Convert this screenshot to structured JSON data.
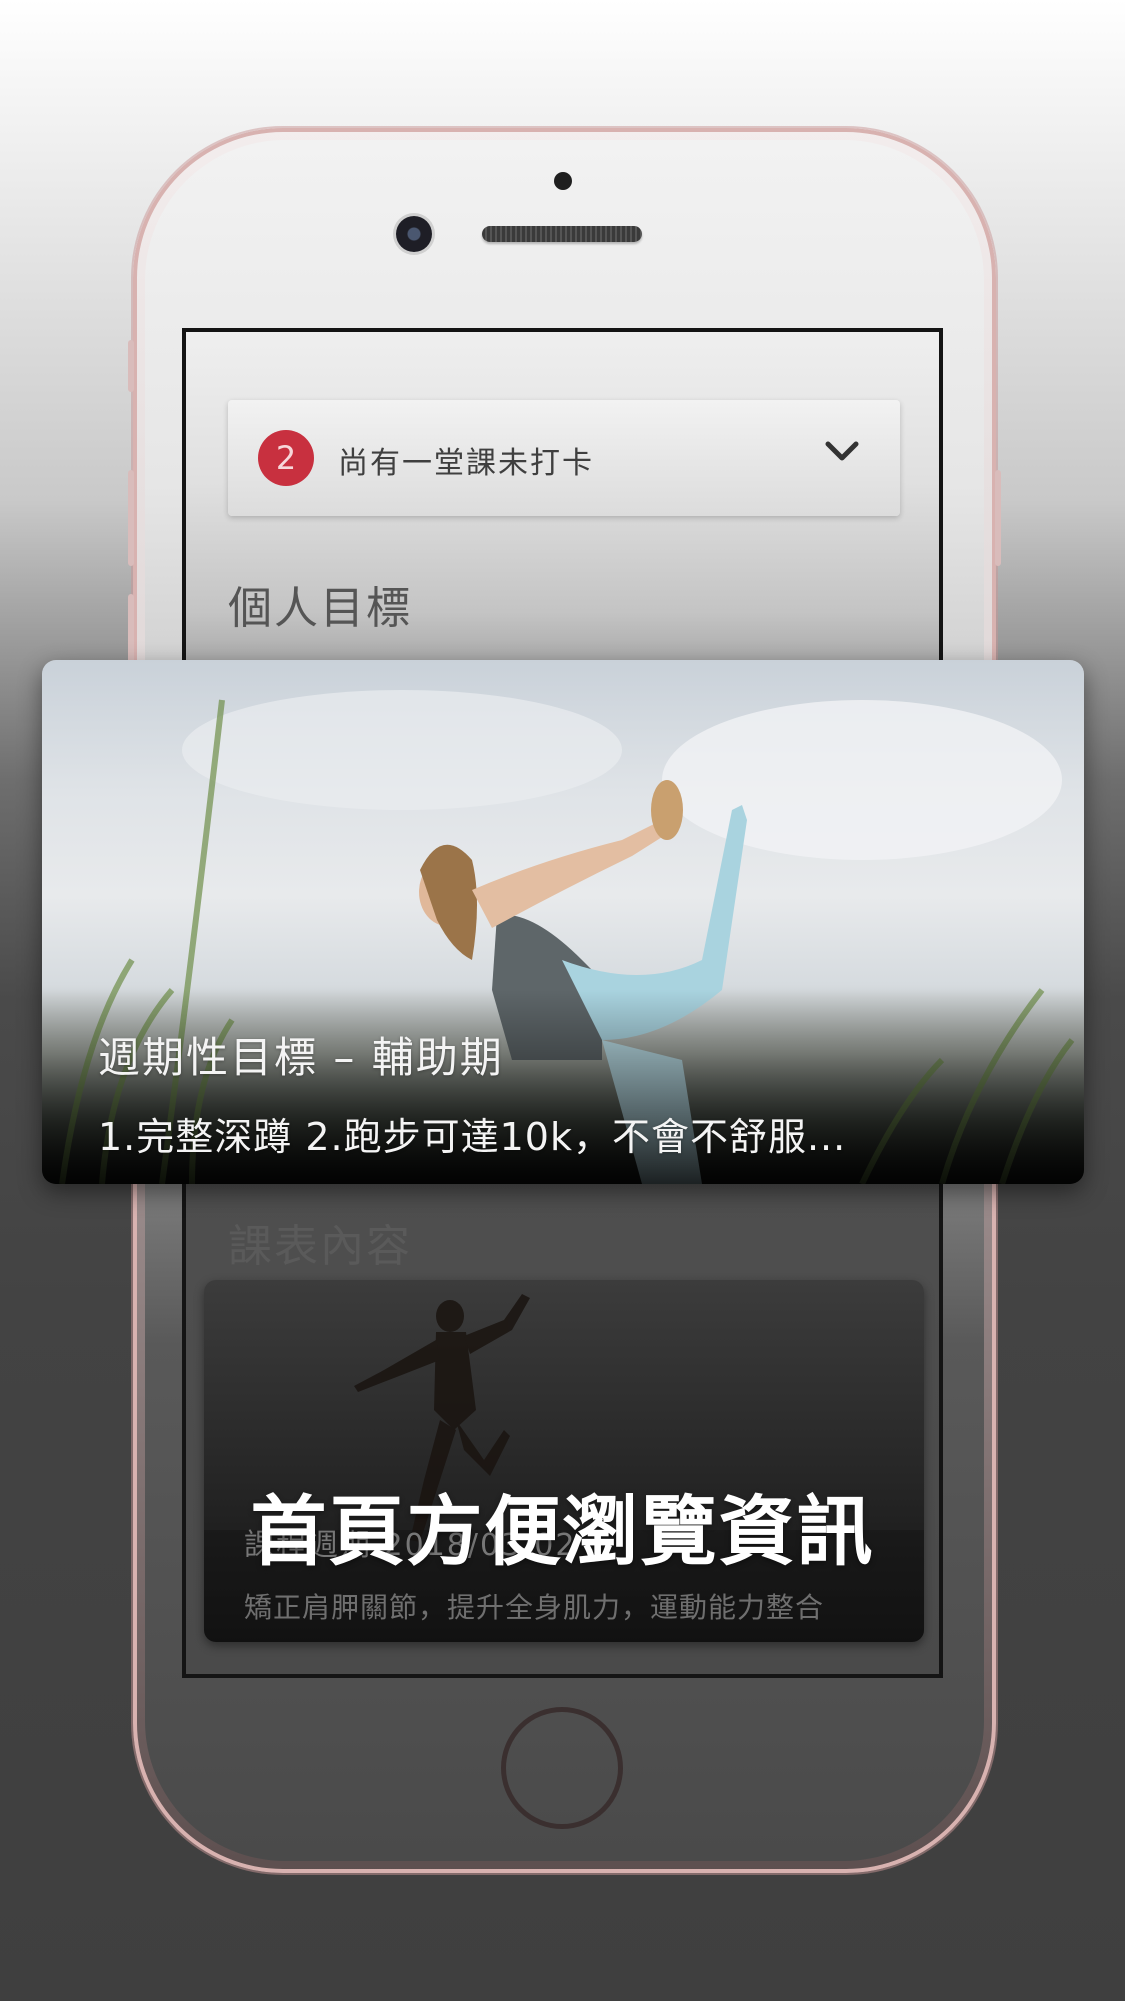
{
  "notification": {
    "badge_count": "2",
    "message": "尚有一堂課未打卡"
  },
  "sections": {
    "personal_goal_title": "個人目標",
    "schedule_title": "課表內容"
  },
  "goal_card": {
    "title": "週期性目標 – 輔助期",
    "description": "1.完整深蹲 2.跑步可達10k，不會不舒服..."
  },
  "course_card": {
    "period": "課程週期 2018/03/02",
    "description": "矯正肩胛關節，提升全身肌力，運動能力整合"
  },
  "caption": "首頁方便瀏覽資訊"
}
